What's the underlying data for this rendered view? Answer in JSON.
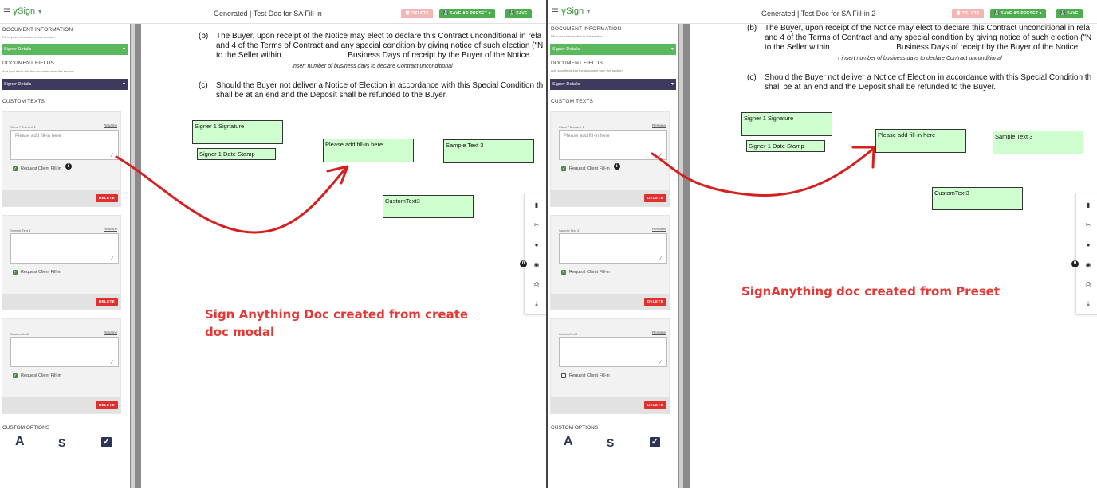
{
  "app": {
    "name": "Sign"
  },
  "panes": [
    {
      "title": "Generated | Test Doc for SA Fill-in",
      "toolbar": {
        "delete": "DELETE",
        "save_preset": "SAVE AS PRESET",
        "save": "SAVE"
      },
      "sidebar": {
        "doc_info_heading": "DOCUMENT INFORMATION",
        "doc_info_sub": "Fill in your information in this section.",
        "doc_info_select": "Signer Details",
        "doc_fields_heading": "DOCUMENT FIELDS",
        "doc_fields_sub": "Add your fields into the document from this section.",
        "doc_fields_select": "Signer Details",
        "custom_texts_heading": "CUSTOM TEXTS",
        "cards": [
          {
            "label": "Client Fill-in text 1",
            "rename": "Rename",
            "placeholder": "Please add fill-in here",
            "checkbox": "Request Client Fill-in",
            "checked": true,
            "delete": "DELETE"
          },
          {
            "label": "Sample Text 3",
            "rename": "Rename",
            "placeholder": "",
            "checkbox": "Request Client Fill-in",
            "checked": true,
            "delete": "DELETE"
          },
          {
            "label": "CustomText3",
            "rename": "Rename",
            "placeholder": "",
            "checkbox": "Request Client Fill-in",
            "checked": true,
            "delete": "DELETE"
          }
        ],
        "custom_options_heading": "CUSTOM OPTIONS"
      },
      "doc": {
        "para_b_label": "(b)",
        "para_b_line1": "The Buyer, upon receipt of the Notice may elect to declare this Contract unconditional in rela",
        "para_b_line2": "and 4 of the Terms of Contract and any special condition by giving notice of such election (\"N",
        "para_b_line3a": "to the Seller within",
        "para_b_line3b": "Business Days of receipt by the Buyer of the Notice.",
        "hint": "insert number of business days to declare Contract unconditional",
        "para_c_label": "(c)",
        "para_c_line1": "Should the Buyer not deliver a Notice of Election in accordance with this Special Condition th",
        "para_c_line2": "shall be at an end and the Deposit shall be refunded to the Buyer.",
        "fields": [
          "Signer 1 Signature",
          "Signer 1 Date Stamp",
          "Please add fill-in here",
          "Sample Text 3",
          "CustomText3"
        ]
      },
      "caption_line1": "Sign Anything Doc created from create",
      "caption_line2": "doc modal"
    },
    {
      "title": "Generated | Test Doc for SA Fill-in 2",
      "toolbar": {
        "delete": "DELETE",
        "save_preset": "SAVE AS PRESET",
        "save": "SAVE"
      },
      "sidebar": {
        "doc_info_heading": "DOCUMENT INFORMATION",
        "doc_info_sub": "Fill in your information in this section.",
        "doc_info_select": "Signer Details",
        "doc_fields_heading": "DOCUMENT FIELDS",
        "doc_fields_sub": "Add your fields into the document from this section.",
        "doc_fields_select": "Signer Details",
        "custom_texts_heading": "CUSTOM TEXTS",
        "cards": [
          {
            "label": "Client Fill-in text 1",
            "rename": "Rename",
            "placeholder": "Please add fill-in here",
            "checkbox": "Request Client Fill-in",
            "checked": true,
            "delete": "DELETE"
          },
          {
            "label": "Sample Text 3",
            "rename": "Rename",
            "placeholder": "",
            "checkbox": "Request Client Fill-in",
            "checked": true,
            "delete": "DELETE"
          },
          {
            "label": "CustomText3",
            "rename": "Rename",
            "placeholder": "",
            "checkbox": "Request Client Fill-in",
            "checked": false,
            "delete": "DELETE"
          }
        ],
        "custom_options_heading": "CUSTOM OPTIONS"
      },
      "doc": {
        "para_b_label": "(b)",
        "para_b_line1": "The Buyer, upon receipt of the Notice may elect to declare this Contract unconditional in rela",
        "para_b_line2": "and 4 of the Terms of Contract and any special condition by giving notice of such election (\"N",
        "para_b_line3a": "to the Seller within",
        "para_b_line3b": "Business Days of receipt by the Buyer of the Notice.",
        "hint": "insert number of business days to declare Contract unconditional",
        "para_c_label": "(c)",
        "para_c_line1": "Should the Buyer not deliver a Notice of Election in accordance with this Special Condition th",
        "para_c_line2": "shall be at an end and the Deposit shall be refunded to the Buyer.",
        "fields": [
          "Signer 1 Signature",
          "Signer 1 Date Stamp",
          "Please add fill-in here",
          "Sample Text 3",
          "CustomText3"
        ]
      },
      "caption_line1": "SignAnything doc created from Preset",
      "caption_line2": ""
    }
  ],
  "icons": {
    "hamburger": "hamburger-icon",
    "logo": "sprout-logo-icon",
    "options": [
      "font-icon",
      "strikethrough-icon",
      "checkbox-icon"
    ],
    "tools": [
      "document-icon",
      "signature-icon",
      "info-icon",
      "stamp-icon",
      "print-icon",
      "download-icon"
    ]
  },
  "colors": {
    "accent_green": "#5cb85c",
    "navy": "#3e3a5e",
    "delete_red": "#e0302e",
    "field_fill": "#cfffcf",
    "annotation_red": "#e53935"
  }
}
